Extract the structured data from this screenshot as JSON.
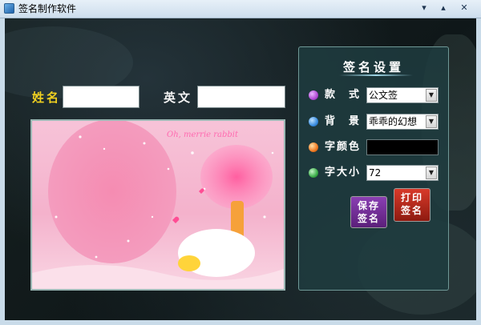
{
  "window": {
    "title": "签名制作软件",
    "minimize_glyph": "▾",
    "maximize_glyph": "▴",
    "close_glyph": "✕"
  },
  "form": {
    "name_label": "姓名",
    "name_value": "",
    "english_label": "英文",
    "english_value": ""
  },
  "preview": {
    "watermark_text": "Oh, merrie rabbit"
  },
  "settings": {
    "title": "签名设置",
    "rows": [
      {
        "label": "款　式",
        "type": "select",
        "value": "公文签",
        "bullet_color": "#b24bd6"
      },
      {
        "label": "背　景",
        "type": "select",
        "value": "乖乖的幻想",
        "bullet_color": "#3a8de0"
      },
      {
        "label": "字颜色",
        "type": "color",
        "value": "#000000",
        "bullet_color": "#f07a22"
      },
      {
        "label": "字大小",
        "type": "select",
        "value": "72",
        "bullet_color": "#3cae4a"
      }
    ],
    "save_label": "保存\n签名",
    "print_label": "打印\n签名"
  }
}
